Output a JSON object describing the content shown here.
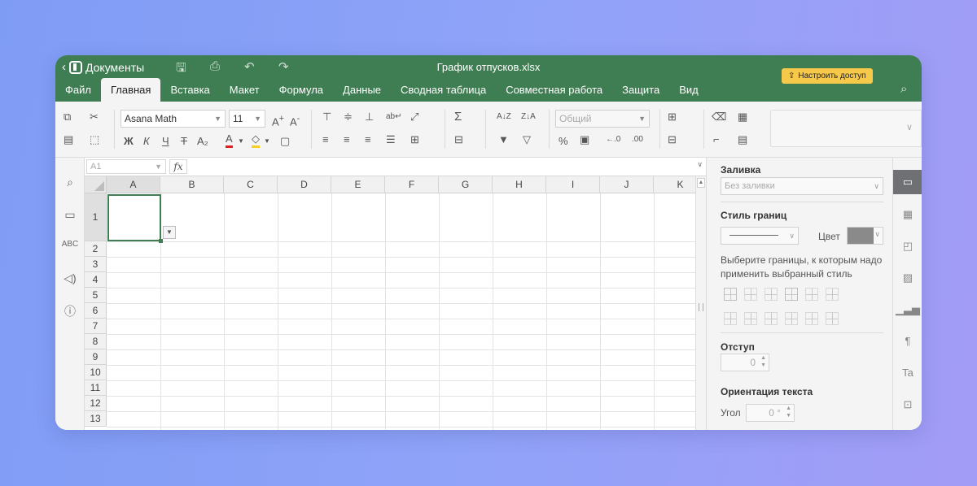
{
  "app": {
    "name": "Документы",
    "doc_title": "График отпусков.xlsx",
    "share_label": "Настроить доступ"
  },
  "menu": [
    "Файл",
    "Главная",
    "Вставка",
    "Макет",
    "Формула",
    "Данные",
    "Сводная таблица",
    "Совместная работа",
    "Защита",
    "Вид"
  ],
  "active_menu": "Главная",
  "toolbar": {
    "font_name": "Asana Math",
    "font_size": "11",
    "number_format": "Общий",
    "bold": "Ж",
    "italic": "К",
    "underline": "Ч",
    "strike": "Т",
    "sum": "Σ",
    "percent": "%"
  },
  "formula_bar": {
    "cell_ref": "A1",
    "fx": "fx"
  },
  "grid": {
    "columns": [
      "A",
      "B",
      "C",
      "D",
      "E",
      "F",
      "G",
      "H",
      "I",
      "J",
      "K"
    ],
    "rows": [
      "1",
      "2",
      "3",
      "4",
      "5",
      "6",
      "7",
      "8",
      "9",
      "10",
      "11",
      "12",
      "13"
    ],
    "active_cell": "A1"
  },
  "panel": {
    "fill_heading": "Заливка",
    "fill_value": "Без заливки",
    "border_heading": "Стиль границ",
    "color_label": "Цвет",
    "border_color": "#8a8a8a",
    "border_hint": "Выберите границы, к которым надо применить выбранный стиль",
    "indent_heading": "Отступ",
    "indent_value": "0",
    "orientation_heading": "Ориентация текста",
    "angle_label": "Угол",
    "angle_value": "0 °"
  },
  "colors": {
    "accent": "#3f7d52",
    "share_bg": "#f6c94a",
    "font_color": "#e02020",
    "highlight": "#f5d020"
  },
  "icons": {
    "left_rail": [
      "search-icon",
      "comment-icon",
      "spellcheck-icon",
      "announce-icon",
      "info-icon"
    ],
    "right_rail": [
      "cell-settings-icon",
      "table-icon",
      "shape-icon",
      "image-icon",
      "chart-icon",
      "paragraph-icon",
      "text-art-icon",
      "pivot-icon"
    ]
  }
}
